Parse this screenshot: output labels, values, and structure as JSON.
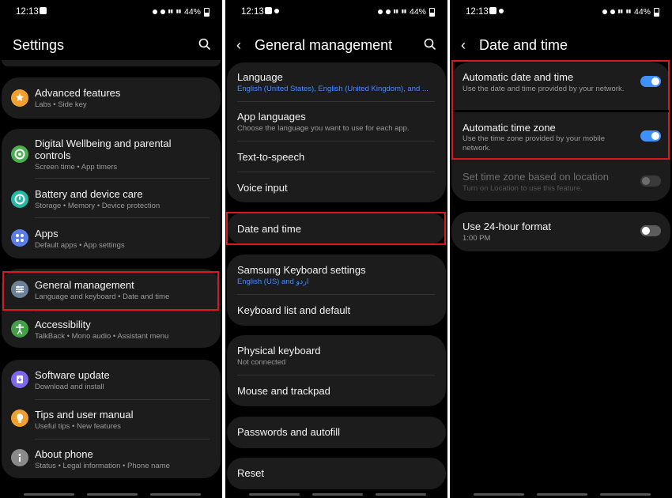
{
  "status": {
    "time": "12:13",
    "battery": "44%"
  },
  "colors": {
    "accent": "#3e91ff",
    "highlight": "#d71920",
    "card": "#1c1c1c"
  },
  "panel1": {
    "title": "Settings",
    "items": [
      {
        "label": "Advanced features",
        "sub": "Labs  •  Side key",
        "icon": "advanced-features-icon",
        "color": "#f0a030"
      },
      {
        "label": "Digital Wellbeing and parental",
        "label2": "controls",
        "sub": "Screen time  •  App timers",
        "icon": "digital-wellbeing-icon",
        "color": "#4caf50"
      },
      {
        "label": "Battery and device care",
        "sub": "Storage  •  Memory  •  Device protection",
        "icon": "battery-care-icon",
        "color": "#26b8a6"
      },
      {
        "label": "Apps",
        "sub": "Default apps  •  App settings",
        "icon": "apps-icon",
        "color": "#5b7de8"
      },
      {
        "label": "General management",
        "sub": "Language and keyboard  •  Date and time",
        "icon": "general-management-icon",
        "color": "#6b8299"
      },
      {
        "label": "Accessibility",
        "sub": "TalkBack  •  Mono audio  •  Assistant menu",
        "icon": "accessibility-icon",
        "color": "#43a047"
      },
      {
        "label": "Software update",
        "sub": "Download and install",
        "icon": "software-update-icon",
        "color": "#7b68ee"
      },
      {
        "label": "Tips and user manual",
        "sub": "Useful tips  •  New features",
        "icon": "tips-icon",
        "color": "#f0a030"
      },
      {
        "label": "About phone",
        "sub": "Status  •  Legal information  •  Phone name",
        "icon": "about-phone-icon",
        "color": "#8a8a8a"
      }
    ]
  },
  "panel2": {
    "title": "General management",
    "items": [
      {
        "label": "Language",
        "sub": "English (United States), English (United Kingdom), and ..."
      },
      {
        "label": "App languages",
        "sub": "Choose the language you want to use for each app."
      },
      {
        "label": "Text-to-speech"
      },
      {
        "label": "Voice input"
      },
      {
        "label": "Date and time"
      },
      {
        "label": "Samsung Keyboard settings",
        "sub": "English (US) and اردو"
      },
      {
        "label": "Keyboard list and default"
      },
      {
        "label": "Physical keyboard",
        "sub": "Not connected"
      },
      {
        "label": "Mouse and trackpad"
      },
      {
        "label": "Passwords and autofill"
      },
      {
        "label": "Reset"
      }
    ]
  },
  "panel3": {
    "title": "Date and time",
    "items": [
      {
        "label": "Automatic date and time",
        "sub": "Use the date and time provided by your network.",
        "state": "on"
      },
      {
        "label": "Automatic time zone",
        "sub": "Use the time zone provided by your mobile",
        "sub2": "network.",
        "state": "on"
      },
      {
        "label": "Set time zone based on location",
        "sub": "Turn on Location to use this feature.",
        "state": "disabled"
      },
      {
        "label": "Use 24-hour format",
        "sub": "1:00 PM",
        "state": "off"
      }
    ]
  }
}
